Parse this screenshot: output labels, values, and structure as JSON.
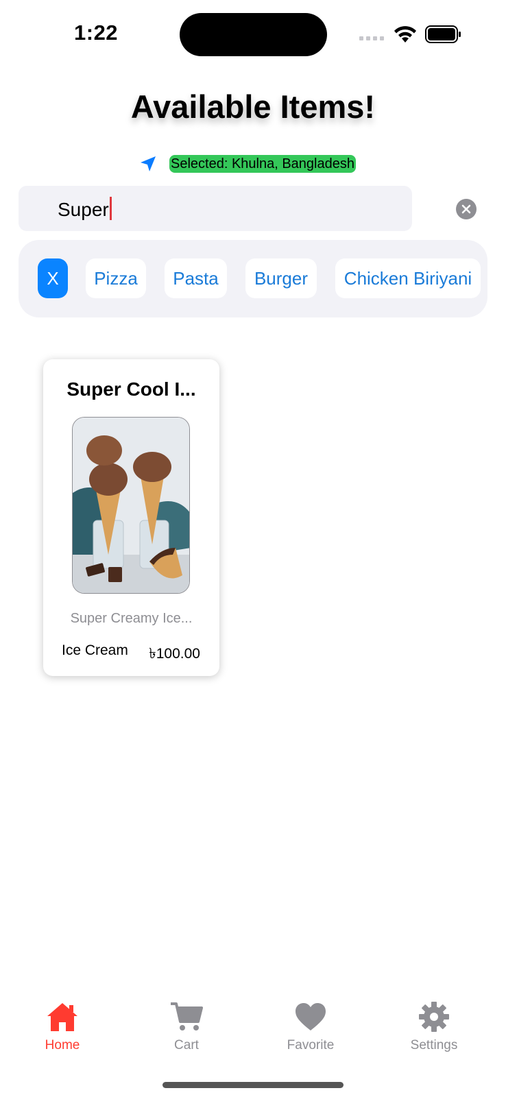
{
  "status_bar": {
    "time": "1:22"
  },
  "header": {
    "title": "Available Items!"
  },
  "location": {
    "icon": "location-arrow-icon",
    "label": "Selected: Khulna, Bangladesh"
  },
  "search": {
    "value": "Super"
  },
  "categories": {
    "clear_label": "X",
    "items": [
      {
        "label": "Pizza"
      },
      {
        "label": "Pasta"
      },
      {
        "label": "Burger"
      },
      {
        "label": "Chicken Biriyani"
      }
    ]
  },
  "products": [
    {
      "title": "Super Cool I...",
      "image": "ice-cream-cones-photo",
      "description": "Super Creamy Ice...",
      "category": "Ice Cream",
      "price": "৳100.00"
    }
  ],
  "tab_bar": {
    "items": [
      {
        "label": "Home",
        "icon": "home-icon",
        "active": true
      },
      {
        "label": "Cart",
        "icon": "cart-icon",
        "active": false
      },
      {
        "label": "Favorite",
        "icon": "heart-icon",
        "active": false
      },
      {
        "label": "Settings",
        "icon": "gear-icon",
        "active": false
      }
    ]
  },
  "colors": {
    "accent": "#ff3b30",
    "chip_text": "#1a7bd8",
    "chip_selected": "#0a84ff",
    "location_highlight": "#34c759",
    "inactive": "#8e8e93"
  }
}
